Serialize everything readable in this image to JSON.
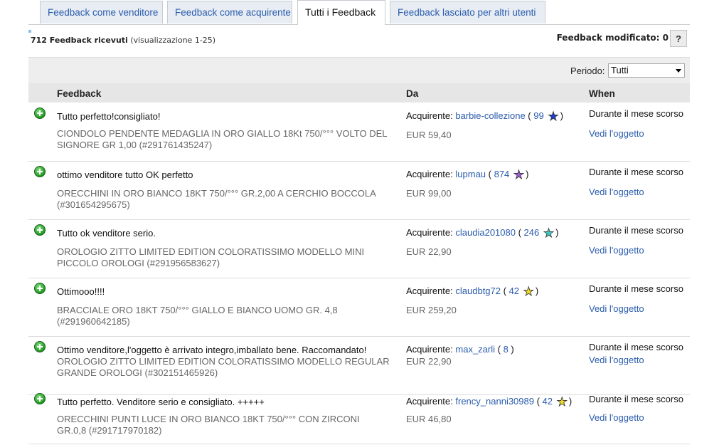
{
  "tabs": [
    {
      "label": "Feedback come venditore",
      "active": false
    },
    {
      "label": "Feedback come acquirente",
      "active": false
    },
    {
      "label": "Tutti i Feedback",
      "active": true
    },
    {
      "label": "Feedback lasciato per altri utenti",
      "active": false
    }
  ],
  "summary": {
    "count": "712 Feedback ricevuti",
    "range": "(visualizzazione 1-25)"
  },
  "modified": {
    "label": "Feedback modificato: 0",
    "help": "?"
  },
  "filter": {
    "label": "Periodo:",
    "value": "Tutti"
  },
  "columns": {
    "feedback": "Feedback",
    "from": "Da",
    "when": "When"
  },
  "colors": {
    "link": "#2a5cad",
    "positive": "#1f9a1f"
  },
  "rows": [
    {
      "comment": "Tutto perfetto!consigliato!",
      "item": "CIONDOLO PENDENTE MEDAGLIA IN ORO GIALLO 18Kt 750/°°° VOLTO DEL SIGNORE GR 1,00 (#291761435247)",
      "role": "Acquirente:",
      "user": "barbie-collezione",
      "score": "99",
      "star_icon": "blue-star-icon",
      "star_color": "#1e3fd0",
      "price": "EUR 59,40",
      "when": "Durante il mese scorso",
      "view": "Vedi l'oggetto"
    },
    {
      "comment": "ottimo venditore tutto OK perfetto",
      "item": "ORECCHINI IN ORO BIANCO 18KT 750/°°° GR.2,00 A CERCHIO BOCCOLA (#301654295675)",
      "role": "Acquirente:",
      "user": "lupmau",
      "score": "874",
      "star_icon": "purple-star-icon",
      "star_color": "#a05ad6",
      "price": "EUR 99,00",
      "when": "Durante il mese scorso",
      "view": "Vedi l'oggetto"
    },
    {
      "comment": "Tutto ok venditore serio.",
      "item": "OROLOGIO ZITTO LIMITED EDITION COLORATISSIMO MODELLO MINI PICCOLO OROLOGI (#291956583627)",
      "role": "Acquirente:",
      "user": "claudia201080",
      "score": "246",
      "star_icon": "turquoise-star-icon",
      "star_color": "#3cc9c4",
      "price": "EUR 22,90",
      "when": "Durante il mese scorso",
      "view": "Vedi l'oggetto"
    },
    {
      "comment": "Ottimooo!!!!",
      "item": "BRACCIALE ORO 18KT 750/°°° GIALLO E BIANCO UOMO GR. 4,8 (#291960642185)",
      "role": "Acquirente:",
      "user": "claudbtg72",
      "score": "42",
      "star_icon": "yellow-star-icon",
      "star_color": "#f2dc2a",
      "price": "EUR 259,20",
      "when": "Durante il mese scorso",
      "view": "Vedi l'oggetto"
    },
    {
      "comment": "Ottimo venditore,l'oggetto è arrivato integro,imballato bene. Raccomandato!",
      "item": "OROLOGIO ZITTO LIMITED EDITION COLORATISSIMO MODELLO REGULAR GRANDE OROLOGI (#302151465926)",
      "role": "Acquirente:",
      "user": "max_zarli",
      "score": "8",
      "star_icon": "",
      "star_color": "",
      "price": "EUR 22,90",
      "when": "Durante il mese scorso",
      "view": "Vedi l'oggetto"
    },
    {
      "comment": "Tutto perfetto. Venditore serio e consigliato. +++++",
      "item": "ORECCHINI PUNTI LUCE IN ORO BIANCO 18KT 750/°°° CON ZIRCONI GR.0,8 (#291717970182)",
      "role": "Acquirente:",
      "user": "frency_nanni30989",
      "score": "42",
      "star_icon": "yellow-star-icon",
      "star_color": "#f2dc2a",
      "price": "EUR 46,80",
      "when": "Durante il mese scorso",
      "view": "Vedi l'oggetto"
    }
  ]
}
